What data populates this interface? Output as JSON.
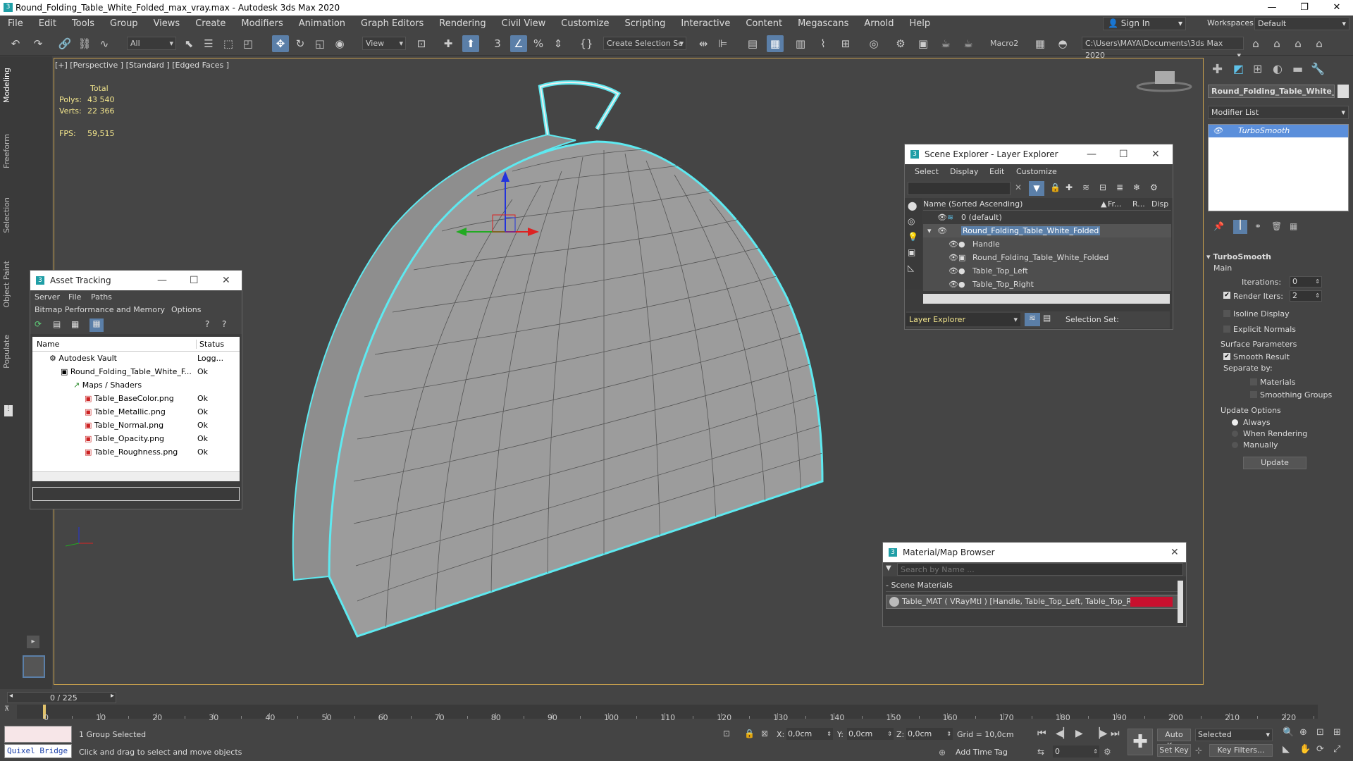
{
  "window": {
    "title": "Round_Folding_Table_White_Folded_max_vray.max - Autodesk 3ds Max 2020",
    "controls": [
      "—",
      "❐",
      "✕"
    ]
  },
  "menubar": {
    "items": [
      "File",
      "Edit",
      "Tools",
      "Group",
      "Views",
      "Create",
      "Modifiers",
      "Animation",
      "Graph Editors",
      "Rendering",
      "Civil View",
      "Customize",
      "Scripting",
      "Interactive",
      "Content",
      "Megascans",
      "Arnold",
      "Help"
    ],
    "sign_in": "Sign In",
    "workspaces_label": "Workspaces:",
    "workspaces_value": "Default"
  },
  "toolbar": {
    "filter_value": "All",
    "view_value": "View",
    "selection_set": "Create Selection Se",
    "macro": "Macro2",
    "project_path": "C:\\Users\\MAYA\\Documents\\3ds Max 2020"
  },
  "left_tabs": [
    "Modeling",
    "Freeform",
    "Selection",
    "Object Paint",
    "Populate"
  ],
  "viewport": {
    "label": "[+] [Perspective ] [Standard ] [Edged Faces ]",
    "stats": {
      "total_label": "Total",
      "polys_label": "Polys:",
      "polys": "43 540",
      "verts_label": "Verts:",
      "verts": "22 366",
      "fps_label": "FPS:",
      "fps": "59,515"
    }
  },
  "asset_tracking": {
    "title": "Asset Tracking",
    "menus": [
      "Server",
      "File",
      "Paths",
      "Bitmap Performance and Memory",
      "Options"
    ],
    "columns": [
      "Name",
      "Status"
    ],
    "rows": [
      {
        "name": "Autodesk Vault",
        "status": "Logg..."
      },
      {
        "name": "Round_Folding_Table_White_F...",
        "status": "Ok"
      },
      {
        "name": "Maps / Shaders",
        "status": ""
      },
      {
        "name": "Table_BaseColor.png",
        "status": "Ok"
      },
      {
        "name": "Table_Metallic.png",
        "status": "Ok"
      },
      {
        "name": "Table_Normal.png",
        "status": "Ok"
      },
      {
        "name": "Table_Opacity.png",
        "status": "Ok"
      },
      {
        "name": "Table_Roughness.png",
        "status": "Ok"
      }
    ]
  },
  "scene_explorer": {
    "title": "Scene Explorer - Layer Explorer",
    "menus": [
      "Select",
      "Display",
      "Edit",
      "Customize"
    ],
    "columns": {
      "name": "Name (Sorted Ascending)",
      "fr": "Fr...",
      "r": "R...",
      "disp": "Disp"
    },
    "rows": [
      "0 (default)",
      "Round_Folding_Table_White_Folded",
      "Handle",
      "Round_Folding_Table_White_Folded",
      "Table_Top_Left",
      "Table_Top_Right"
    ],
    "footer_dropdown": "Layer Explorer",
    "selection_set_label": "Selection Set:"
  },
  "material_browser": {
    "title": "Material/Map Browser",
    "search_placeholder": "Search by Name ...",
    "group": "- Scene Materials",
    "material": "Table_MAT  ( VRayMtl )  [Handle, Table_Top_Left, Table_Top_Right]",
    "swatch_color": "#c8102e"
  },
  "command_panel": {
    "object_name": "Round_Folding_Table_White_",
    "modifier_list": "Modifier List",
    "stack_item": "TurboSmooth",
    "rollout_title": "TurboSmooth",
    "main_label": "Main",
    "iterations_label": "Iterations:",
    "iterations": "0",
    "render_iters_label": "Render Iters:",
    "render_iters": "2",
    "isoline": "Isoline Display",
    "explicit_normals": "Explicit Normals",
    "surface_params": "Surface Parameters",
    "smooth_result": "Smooth Result",
    "separate_by": "Separate by:",
    "materials": "Materials",
    "smoothing_groups": "Smoothing Groups",
    "update_options": "Update Options",
    "always": "Always",
    "when_rendering": "When Rendering",
    "manually": "Manually",
    "update_button": "Update"
  },
  "timeline": {
    "frame": "0 / 225",
    "ticks": [
      "0",
      "10",
      "20",
      "30",
      "40",
      "50",
      "60",
      "70",
      "80",
      "90",
      "100",
      "110",
      "120",
      "130",
      "140",
      "150",
      "160",
      "170",
      "180",
      "190",
      "200",
      "210",
      "220"
    ]
  },
  "status": {
    "quixel": "Quixel Bridge",
    "selection": "1 Group Selected",
    "prompt": "Click and drag to select and move objects",
    "x_label": "X:",
    "x": "0,0cm",
    "y_label": "Y:",
    "y": "0,0cm",
    "z_label": "Z:",
    "z": "0,0cm",
    "grid": "Grid = 10,0cm",
    "add_time_tag": "Add Time Tag",
    "auto_key": "Auto Key",
    "set_key": "Set Key",
    "selected": "Selected",
    "key_filters": "Key Filters...",
    "frame_field": "0"
  }
}
